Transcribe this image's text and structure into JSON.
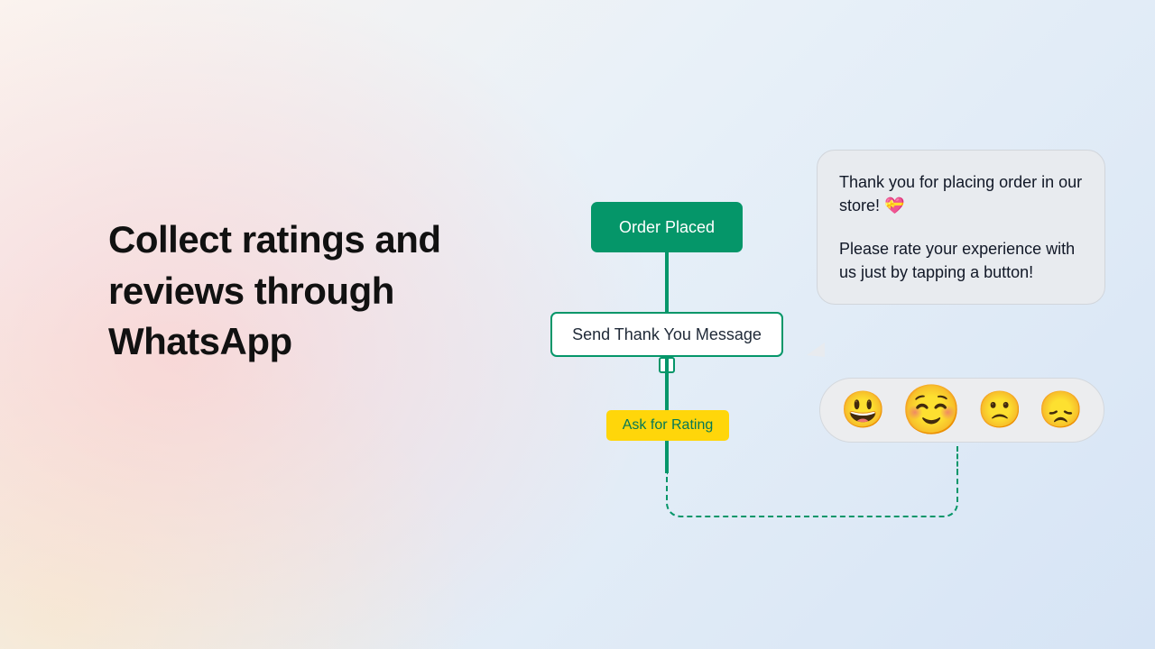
{
  "headline": "Collect ratings and reviews through WhatsApp",
  "flow": {
    "order_placed": "Order Placed",
    "thank_you": "Send Thank You Message",
    "ask_rating": "Ask for Rating"
  },
  "chat": {
    "line1": "Thank you for placing order in our store! 💝",
    "line2": "Please rate your experience with us just by tapping a button!"
  },
  "emojis": {
    "happy": "😃",
    "pleased": "☺️",
    "sad": "🙁",
    "disappointed": "😞"
  },
  "icons": {
    "arrow_down": "↓"
  }
}
